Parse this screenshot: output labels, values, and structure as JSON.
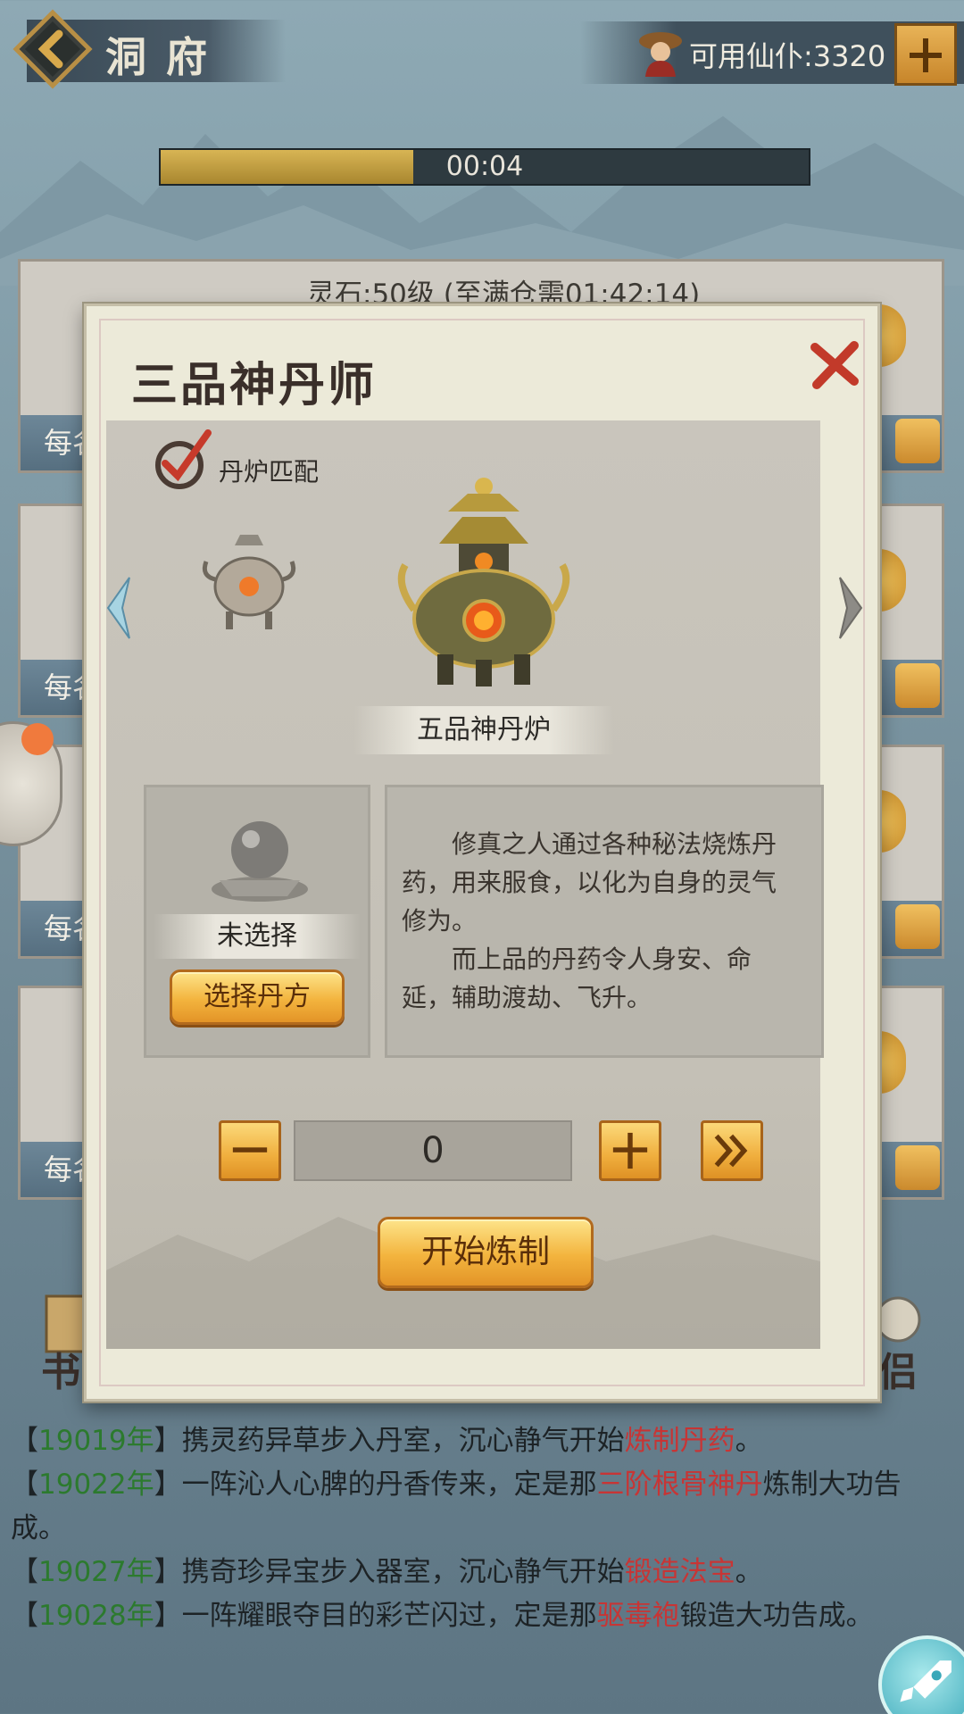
{
  "header": {
    "title": "洞府",
    "servants_label": "可用仙仆:3320"
  },
  "timer": {
    "text": "00:04",
    "progress": 0.39
  },
  "background": {
    "spirit_stone_text": "灵石:50级 (至满仓需01:42:14)",
    "card_labels": [
      "每名",
      "每名",
      "每名",
      "每名"
    ],
    "side_left_text": "书",
    "side_right_text": "侣"
  },
  "modal": {
    "title": "三品神丹师",
    "furnace_match_label": "丹炉匹配",
    "furnace_name": "五品神丹炉",
    "recipe_status": "未选择",
    "select_recipe_label": "选择丹方",
    "description": [
      "修真之人通过各种秘法烧炼丹药，用来服食，以化为自身的灵气修为。",
      "而上品的丹药令人身安、命延，辅助渡劫、飞升。"
    ],
    "quantity": "0",
    "start_label": "开始炼制"
  },
  "log": [
    {
      "open": "【",
      "year": "19019年",
      "close": "】",
      "text": "携灵药异草步入丹室，沉心静气开始",
      "highlight": "炼制丹药",
      "tail": "。"
    },
    {
      "open": "【",
      "year": "19022年",
      "close": "】",
      "text": "一阵沁人心脾的丹香传来，定是那",
      "highlight": "三阶根骨神丹",
      "tail": "炼制大功告成。"
    },
    {
      "open": "【",
      "year": "19027年",
      "close": "】",
      "text": "携奇珍异宝步入器室，沉心静气开始",
      "highlight": "锻造法宝",
      "tail": "。"
    },
    {
      "open": "【",
      "year": "19028年",
      "close": "】",
      "text": "一阵耀眼夺目的彩芒闪过，定是那",
      "highlight": "驱毒袍",
      "tail": "锻造大功告成。"
    }
  ],
  "colors": {
    "year": "#2c7a2e",
    "highlight": "#c73535",
    "gold": "#f0ae3d"
  },
  "icons": {
    "back": "back-arrow-icon",
    "servant": "servant-avatar-icon",
    "add": "plus-icon",
    "close": "close-x-icon",
    "check": "checkmark-icon",
    "furnace": "alchemy-furnace-icon",
    "pill": "pill-orb-icon",
    "rocket": "rocket-icon"
  }
}
